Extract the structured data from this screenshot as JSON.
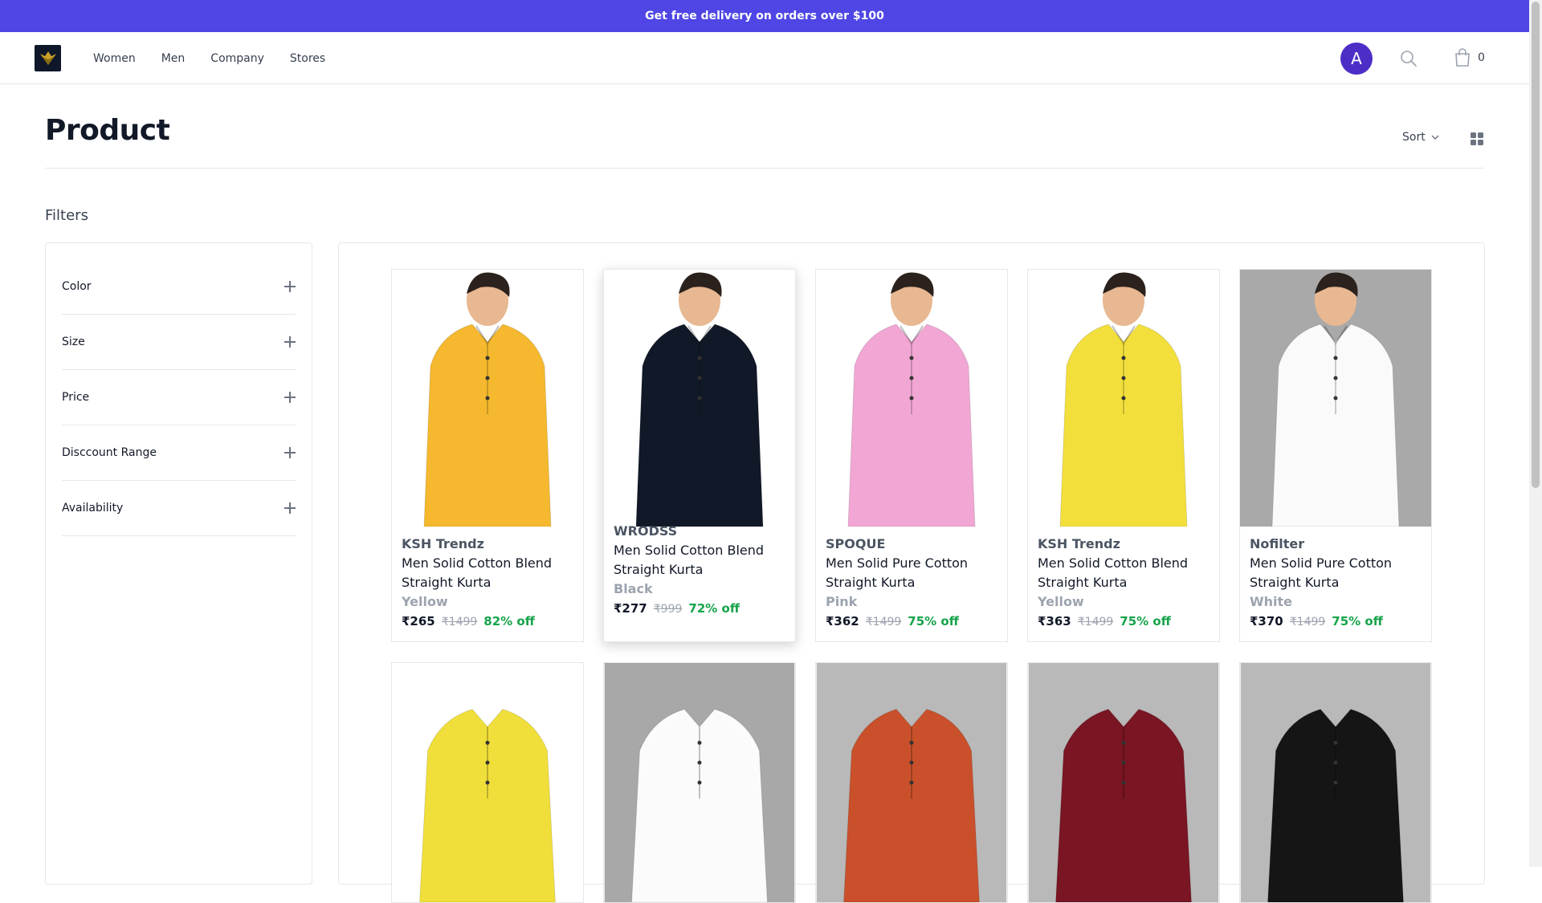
{
  "announcement": "Get free delivery on orders over $100",
  "nav": [
    "Women",
    "Men",
    "Company",
    "Stores"
  ],
  "user_initial": "A",
  "cart_count": "0",
  "page_title": "Product",
  "sort_label": "Sort",
  "filters_label": "Filters",
  "filters": [
    "Color",
    "Size",
    "Price",
    "Disccount Range",
    "Availability"
  ],
  "products": [
    {
      "brand": "KSH Trendz",
      "name": "Men Solid Cotton Blend Straight Kurta",
      "color": "Yellow",
      "price": "₹265",
      "mrp": "₹1499",
      "off": "82% off",
      "shirt_color": "#f5b82e"
    },
    {
      "brand": "WRODSS",
      "name": "Men Solid Cotton Blend Straight Kurta",
      "color": "Black",
      "price": "₹277",
      "mrp": "₹999",
      "off": "72% off",
      "shirt_color": "#111827"
    },
    {
      "brand": "SPOQUE",
      "name": "Men Solid Pure Cotton Straight Kurta",
      "color": "Pink",
      "price": "₹362",
      "mrp": "₹1499",
      "off": "75% off",
      "shirt_color": "#f2a6d4"
    },
    {
      "brand": "KSH Trendz",
      "name": "Men Solid Cotton Blend Straight Kurta",
      "color": "Yellow",
      "price": "₹363",
      "mrp": "₹1499",
      "off": "75% off",
      "shirt_color": "#f3df3c"
    },
    {
      "brand": "Nofilter",
      "name": "Men Solid Pure Cotton Straight Kurta",
      "color": "White",
      "price": "₹370",
      "mrp": "₹1499",
      "off": "75% off",
      "shirt_color": "#fafafa"
    }
  ],
  "row2_colors": [
    "#f0df3a",
    "#fbfbfb",
    "#c9502a",
    "#7a1523",
    "#151515"
  ],
  "colors": {
    "accent": "#4f46e5",
    "avatar": "#4c2ec7",
    "discount": "#16a34a"
  }
}
